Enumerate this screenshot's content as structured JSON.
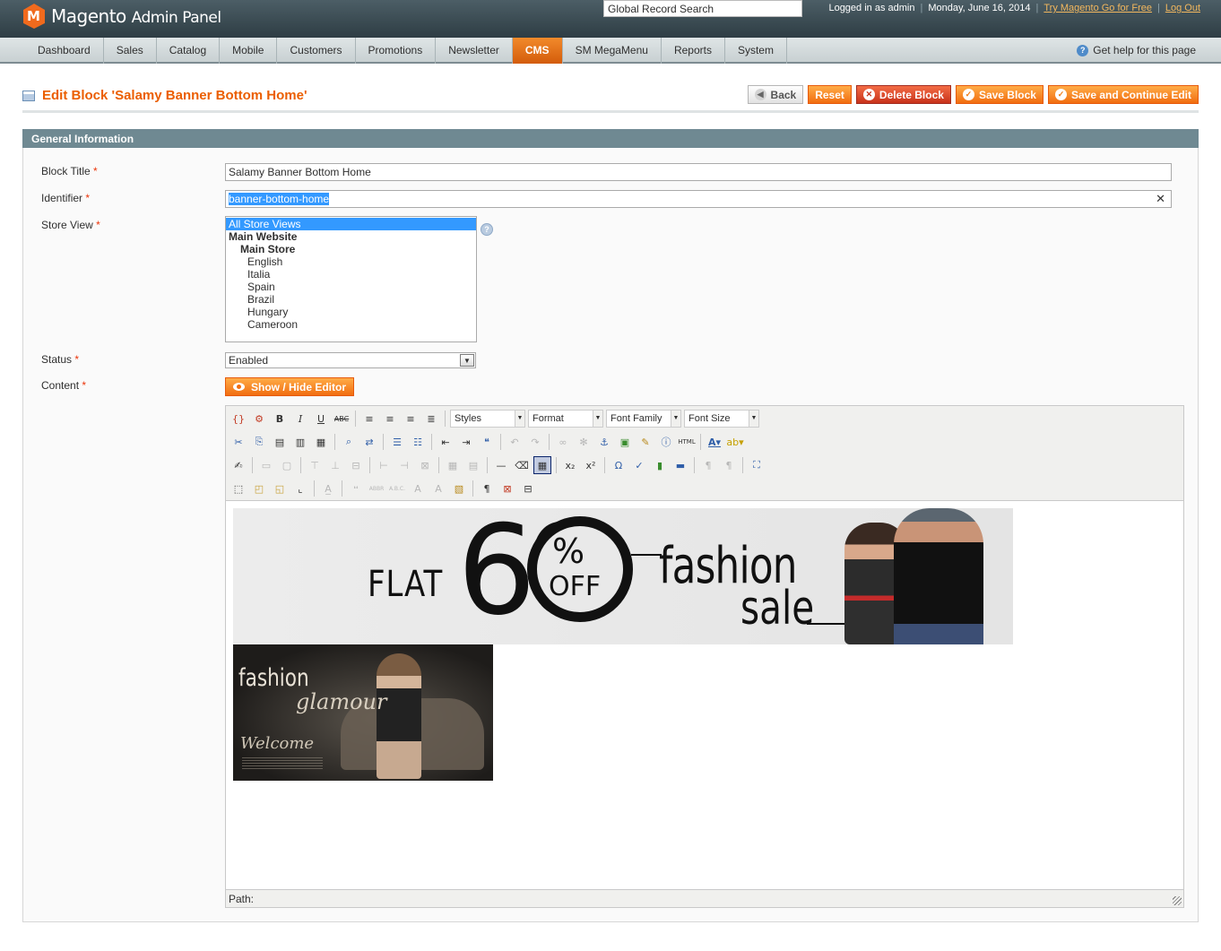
{
  "header": {
    "logo": "Magento",
    "logo_sub": "Admin Panel",
    "search_value": "Global Record Search",
    "logged_in": "Logged in as admin",
    "date": "Monday, June 16, 2014",
    "try_link": "Try Magento Go for Free",
    "logout": "Log Out"
  },
  "nav": {
    "items": [
      "Dashboard",
      "Sales",
      "Catalog",
      "Mobile",
      "Customers",
      "Promotions",
      "Newsletter",
      "CMS",
      "SM MegaMenu",
      "Reports",
      "System"
    ],
    "active": "CMS",
    "help": "Get help for this page"
  },
  "page": {
    "title": "Edit Block 'Salamy Banner Bottom Home'",
    "buttons": {
      "back": "Back",
      "reset": "Reset",
      "delete": "Delete Block",
      "save": "Save Block",
      "save_continue": "Save and Continue Edit"
    }
  },
  "form": {
    "section_title": "General Information",
    "block_title_label": "Block Title",
    "block_title_value": "Salamy Banner Bottom Home",
    "identifier_label": "Identifier",
    "identifier_value": "banner-bottom-home",
    "store_view_label": "Store View",
    "store_views": [
      "All Store Views",
      "Main Website",
      "Main Store",
      "English",
      "Italia",
      "Spain",
      "Brazil",
      "Hungary",
      "Cameroon"
    ],
    "store_view_selected": "All Store Views",
    "status_label": "Status",
    "status_value": "Enabled",
    "content_label": "Content",
    "show_hide": "Show / Hide Editor",
    "required_mark": "*"
  },
  "editor": {
    "selects": [
      "Styles",
      "Format",
      "Font Family",
      "Font Size"
    ],
    "path_label": "Path:",
    "banner1": {
      "flat": "FLAT",
      "number": "60",
      "pct": "%",
      "off": "OFF",
      "fashion": "fashion",
      "sale": "sale"
    },
    "banner2": {
      "fashion": "fashion",
      "glamour": "glamour",
      "welcome": "Welcome"
    }
  },
  "colors": {
    "accent": "#eb5e00",
    "header_bg": "#2e3d44",
    "section_bg": "#6f8992",
    "selection": "#3399ff"
  }
}
